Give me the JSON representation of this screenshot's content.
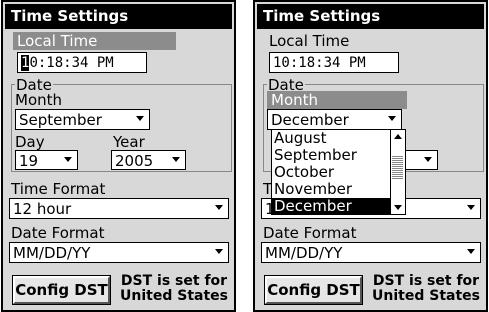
{
  "left": {
    "title": "Time Settings",
    "local_time_label": "Local Time",
    "local_time_cursor_char": "1",
    "local_time_rest": "0:18:34 PM",
    "date_label": "Date",
    "month_label": "Month",
    "month_value": "September",
    "day_label": "Day",
    "day_value": "19",
    "year_label": "Year",
    "year_value": "2005",
    "time_format_label": "Time Format",
    "time_format_value": "12 hour",
    "date_format_label": "Date Format",
    "date_format_value": "MM/DD/YY",
    "config_dst_label": "Config DST",
    "dst_note_line1": "DST is set for",
    "dst_note_line2": "United States"
  },
  "right": {
    "title": "Time Settings",
    "local_time_label": "Local Time",
    "local_time_value": "10:18:34 PM",
    "date_label": "Date",
    "month_label": "Month",
    "month_value": "December",
    "month_options": [
      "August",
      "September",
      "October",
      "November",
      "December"
    ],
    "month_selected_index": 4,
    "time_format_label_partial": "T",
    "time_format_value_partial": "1",
    "date_format_label": "Date Format",
    "date_format_value": "MM/DD/YY",
    "config_dst_label": "Config DST",
    "dst_note_line1": "DST is set for",
    "dst_note_line2": "United States"
  }
}
